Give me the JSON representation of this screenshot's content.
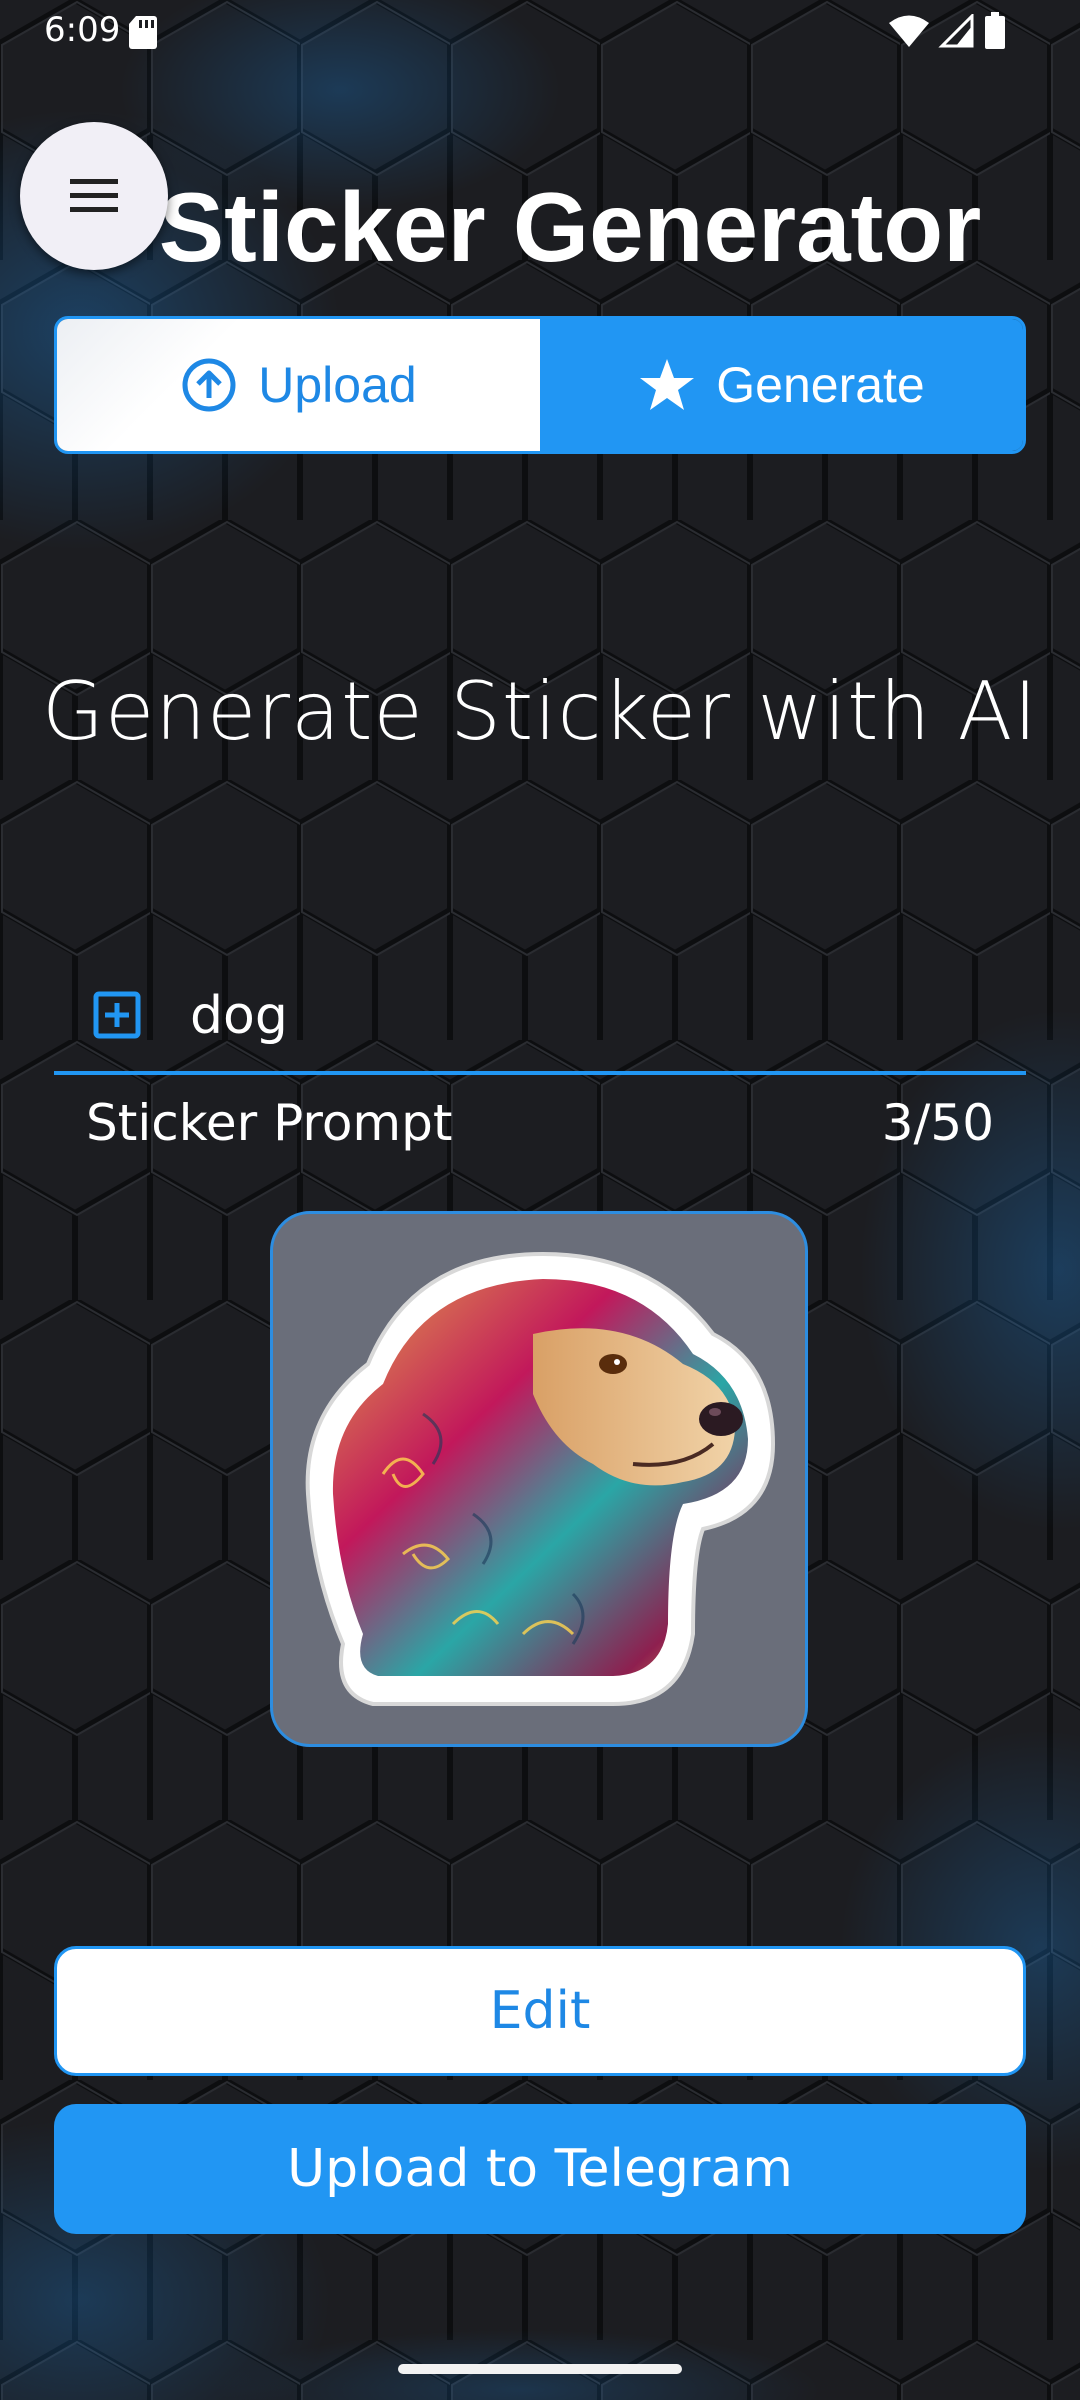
{
  "status_bar": {
    "time": "6:09"
  },
  "app": {
    "title": "Sticker Generator"
  },
  "tabs": [
    {
      "label": "Upload",
      "icon": "upload-circle-icon",
      "selected": false
    },
    {
      "label": "Generate",
      "icon": "star-icon",
      "selected": true
    }
  ],
  "main": {
    "heading": "Generate Sticker with AI",
    "prompt": {
      "value": "dog",
      "label": "Sticker Prompt",
      "counter": "3/50"
    },
    "preview_icon": "dog-sticker-image"
  },
  "actions": {
    "edit_label": "Edit",
    "telegram_label": "Upload to Telegram"
  },
  "colors": {
    "accent": "#2196f3",
    "background": "#161719",
    "honeycomb_glow": "#1e88e5",
    "card": "#6a6e7a"
  }
}
